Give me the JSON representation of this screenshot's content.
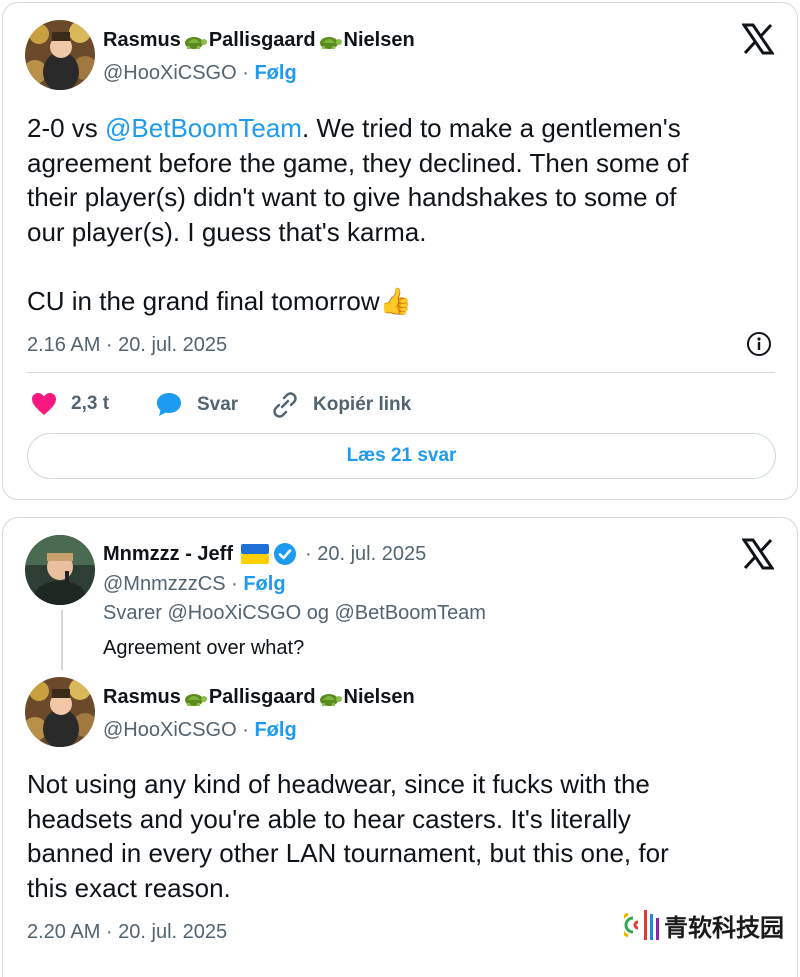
{
  "tweet1": {
    "author_first": "Rasmus",
    "author_middle": "Pallisgaard",
    "author_last": "Nielsen",
    "handle": "@HooXiCSGO",
    "separator": "·",
    "follow": "Følg",
    "line1_pre": "2-0 vs ",
    "line1_mention": "@BetBoomTeam",
    "line1_post": ". We tried to make a gentlemen's",
    "line2": "agreement before the game, they declined. Then some of",
    "line3": "their player(s) didn't want to give handshakes to some of",
    "line4": "our player(s). I guess that's karma.",
    "line5": "CU in the grand final tomorrow",
    "emoji": "👍",
    "time": "2.16 AM · 20. jul. 2025",
    "likes": "2,3 t",
    "reply": "Svar",
    "copy_link": "Kopiér link",
    "read_replies": "Læs 21 svar"
  },
  "tweet2": {
    "parent": {
      "author": "Mnmzzz - Jeff",
      "date": "· 20. jul. 2025",
      "handle": "@MnmzzzCS",
      "separator": "·",
      "follow": "Følg",
      "replying_to": "Svarer @HooXiCSGO og @BetBoomTeam",
      "text": "Agreement over what?"
    },
    "reply": {
      "author_first": "Rasmus",
      "author_middle": "Pallisgaard",
      "author_last": "Nielsen",
      "handle": "@HooXiCSGO",
      "separator": "·",
      "follow": "Følg",
      "line1": "Not using any kind of headwear, since it fucks with the",
      "line2": "headsets and you're able to hear casters. It's literally",
      "line3": "banned in every other LAN tournament, but this one, for",
      "line4": "this exact reason.",
      "time": "2.20 AM · 20. jul. 2025"
    }
  },
  "watermark": "青软科技园",
  "colors": {
    "accent": "#1d9bf0",
    "like": "#f91880",
    "muted": "#536471",
    "border": "#cfd9de"
  },
  "icons": [
    "x-logo-icon",
    "turtle-icon",
    "ukraine-flag-icon",
    "verified-badge-icon",
    "heart-icon",
    "reply-bubble-icon",
    "link-icon",
    "info-icon"
  ]
}
